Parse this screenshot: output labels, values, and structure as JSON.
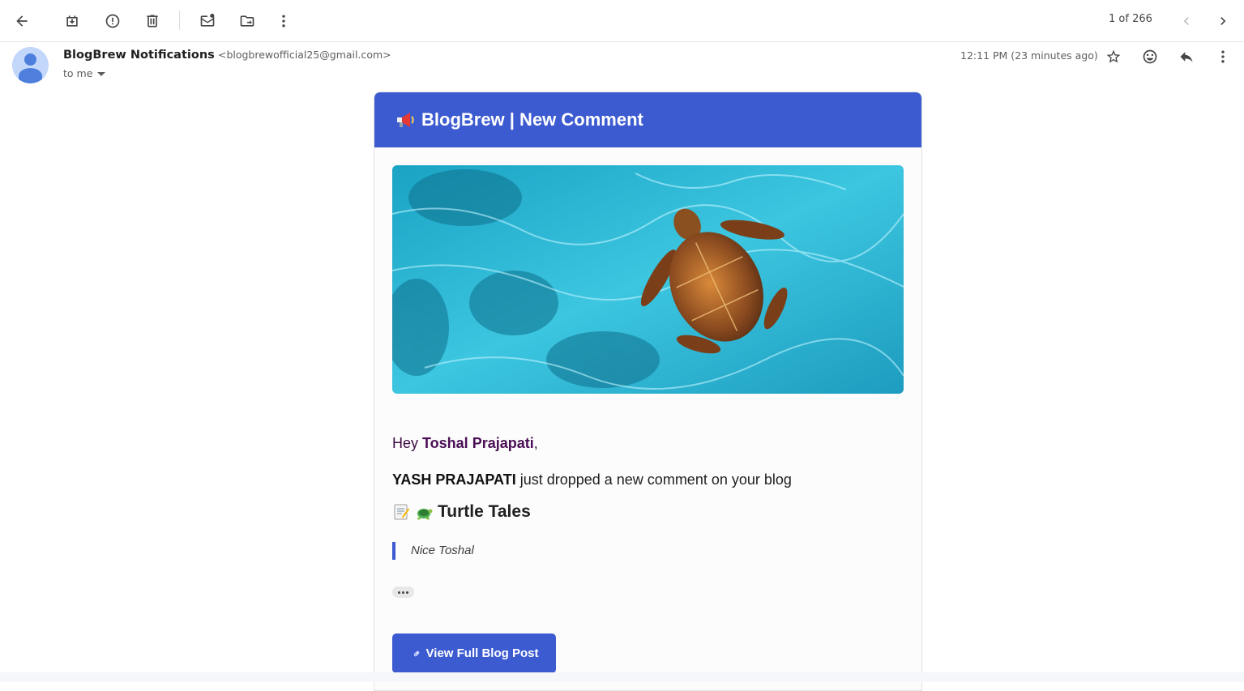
{
  "toolbar": {
    "page_count": "1 of 266",
    "icons": [
      "back-arrow-icon",
      "archive-icon",
      "report-spam-icon",
      "delete-icon",
      "mark-unread-icon",
      "move-to-icon",
      "more-vert-icon",
      "newer-chevron-icon",
      "older-chevron-icon"
    ]
  },
  "message": {
    "sender_name": "BlogBrew Notifications",
    "sender_email": "<blogbrewofficial25@gmail.com>",
    "recipient": "to me",
    "timestamp": "12:11 PM (23 minutes ago)",
    "actions": [
      "star-icon",
      "emoji-react-icon",
      "reply-icon",
      "more-vert-icon"
    ]
  },
  "email": {
    "header_title": "BlogBrew | New Comment",
    "greeting_prefix": "Hey ",
    "recipient_name": "Toshal Prajapati",
    "greeting_suffix": ",",
    "commenter": "YASH PRAJAPATI",
    "comment_text": " just dropped a new comment on your blog",
    "blog_title": "Turtle Tales",
    "comment_quote": "Nice Toshal",
    "cta_label": "View Full Blog Post",
    "accent_color": "#3d5bd1"
  }
}
